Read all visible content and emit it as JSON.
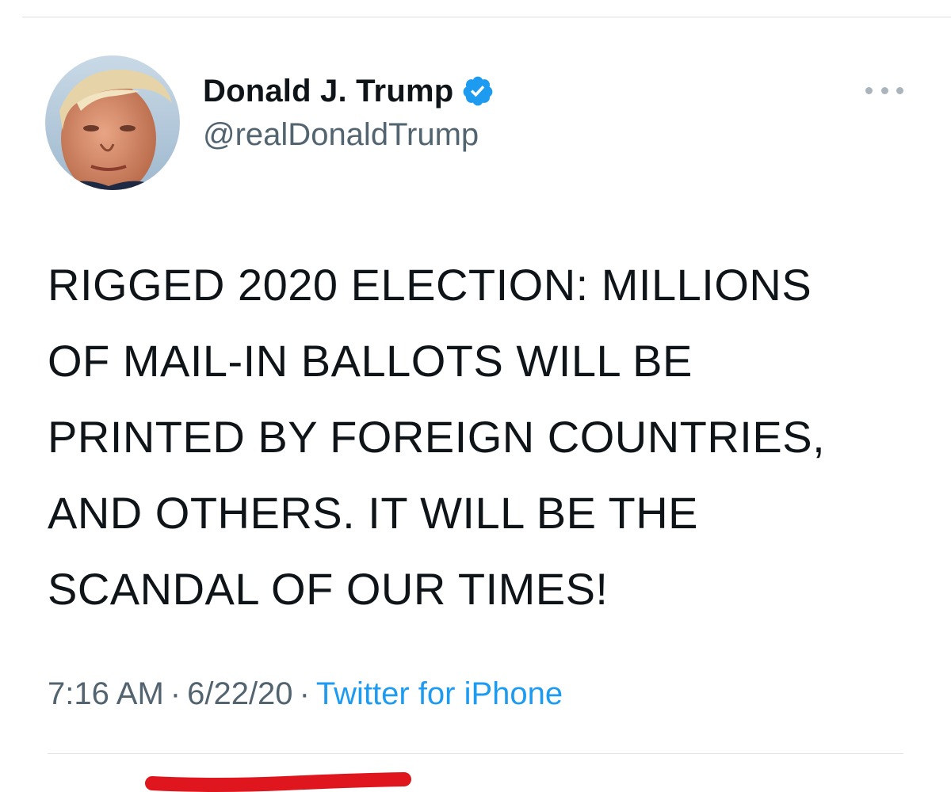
{
  "tweet": {
    "author": {
      "display_name": "Donald J. Trump",
      "handle": "@realDonaldTrump",
      "verified": true,
      "avatar_icon": "profile-avatar"
    },
    "more_icon": "more-options-icon",
    "text_lines": [
      "RIGGED 2020 ELECTION: MILLIONS",
      "OF MAIL-IN BALLOTS WILL BE",
      "PRINTED BY FOREIGN COUNTRIES,",
      "AND OTHERS. IT WILL BE THE",
      "SCANDAL OF OUR TIMES!"
    ],
    "time": "7:16 AM",
    "date": "6/22/20",
    "separator": "·",
    "source": "Twitter for iPhone"
  },
  "colors": {
    "verified_badge": "#1d9bf0",
    "source_link": "#1d9bf0",
    "secondary_text": "#536471",
    "annotation_underline": "#e0161e"
  }
}
